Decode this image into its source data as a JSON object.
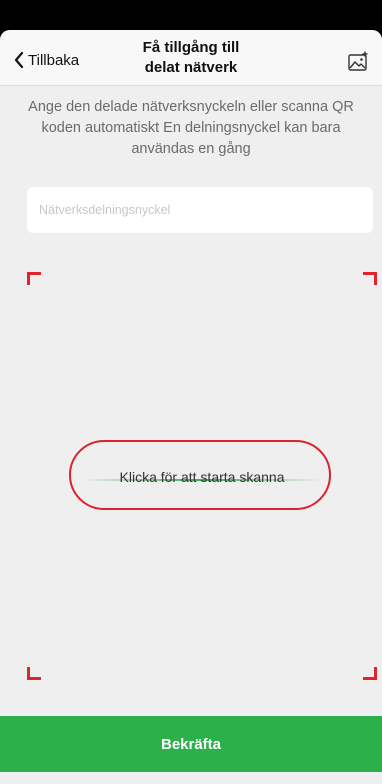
{
  "navbar": {
    "back_label": "Tillbaka",
    "title_line1": "Få tillgång till",
    "title_line2": "delat nätverk",
    "right_icon": "gallery-icon"
  },
  "description": "Ange den delade nätverksnyckeln eller scanna QR koden automatiskt  En delningsnyckel kan bara användas en gång",
  "key_input": {
    "placeholder": "Nätverksdelningsnyckel",
    "value": ""
  },
  "scanner": {
    "label": "Klicka för att starta skanna",
    "corner_color": "#e0242b",
    "scan_line_color": "#28a046",
    "highlight_color": "#d9232e"
  },
  "confirm": {
    "label": "Bekräfta",
    "color": "#2cb14a"
  }
}
